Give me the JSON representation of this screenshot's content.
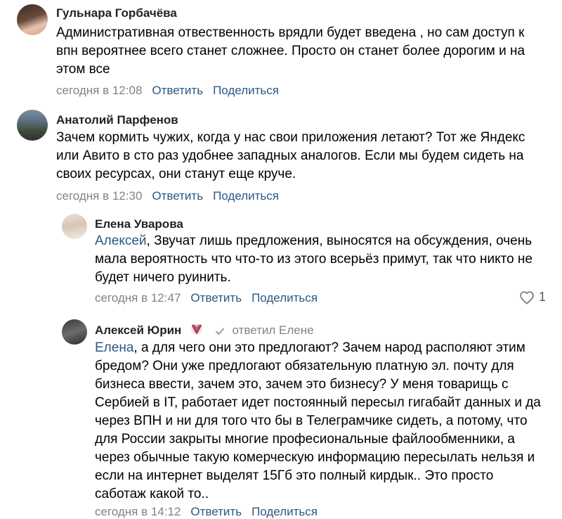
{
  "comments": [
    {
      "author": "Гульнара Горбачёва",
      "text": "Административная отвественность врядли будет введена , но сам доступ к впн вероятнее всего станет сложнее. Просто он станет более дорогим и на этом все",
      "time": "сегодня в 12:08",
      "reply_label": "Ответить",
      "share_label": "Поделиться"
    },
    {
      "author": "Анатолий Парфенов",
      "text": "Зачем кормить чужих, когда у нас свои приложения летают? Тот же Яндекс или Авито в сто раз удобнее западных аналогов. Если мы будем сидеть на своих ресурсах, они станут еще круче.",
      "time": "сегодня в 12:30",
      "reply_label": "Ответить",
      "share_label": "Поделиться"
    },
    {
      "author": "Елена Уварова",
      "mention": "Алексей",
      "text": ", Звучат лишь предложения, выносятся на обсуждения, очень мала вероятность что что-то из этого всерьёз примут, так что никто не будет ничего руинить.",
      "time": "сегодня в 12:47",
      "reply_label": "Ответить",
      "share_label": "Поделиться",
      "likes": "1"
    },
    {
      "author": "Алексей Юрин",
      "replied_to": "ответил Елене",
      "mention": "Елена",
      "text": ", а для чего они это предлогают? Зачем народ располяют этим бредом? Они уже предлогают обязательную платную эл. почту для бизнеса ввести, зачем это, зачем это бизнесу? У меня товарищь с Сербией в IT, работает идет постоянный пересыл гигабайт данных и да через ВПН и ни для того что бы в Телеграмчике сидеть, а потому, что для России закрыты многие професиональные файлообменники, а через обычные такую комерческую информацию пересылать нельзя и если на интернет выделят 15Гб это полный кирдык.. Это просто саботаж какой то..",
      "time": "сегодня в 14:12",
      "reply_label": "Ответить",
      "share_label": "Поделиться"
    }
  ],
  "colors": {
    "link": "#2a5885",
    "meta": "#828282",
    "text": "#000000"
  }
}
